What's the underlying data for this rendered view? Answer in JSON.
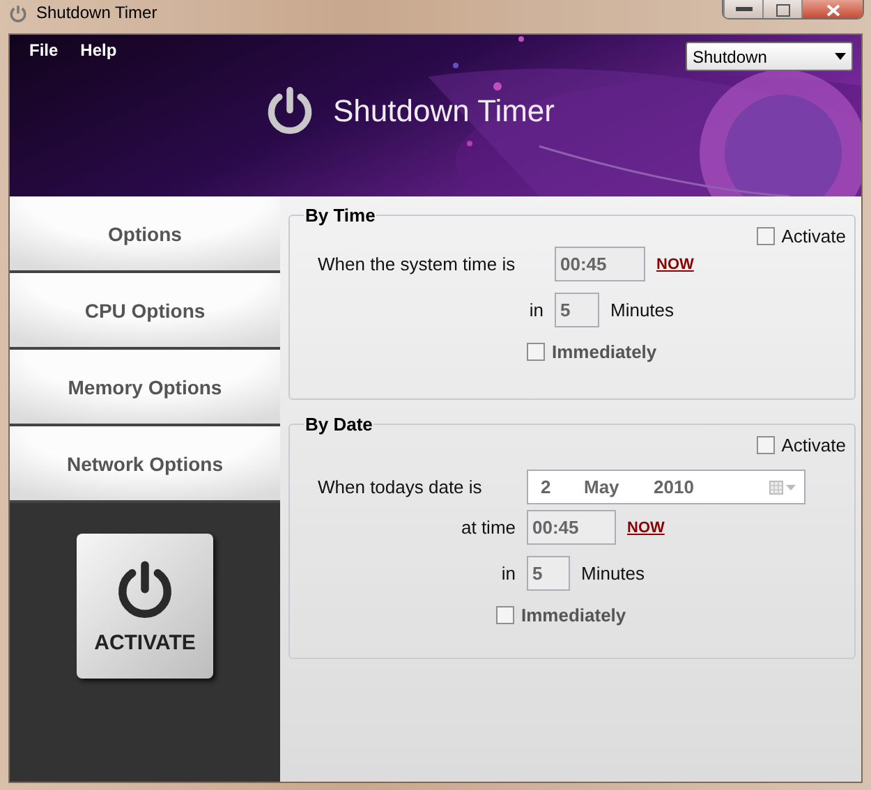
{
  "window": {
    "title": "Shutdown Timer"
  },
  "menu": [
    {
      "label": "File"
    },
    {
      "label": "Help"
    }
  ],
  "action_select": {
    "value": "Shutdown"
  },
  "banner": {
    "title": "Shutdown Timer"
  },
  "sidebar": {
    "items": [
      {
        "label": "Options",
        "selected": false
      },
      {
        "label": "CPU Options",
        "selected": false
      },
      {
        "label": "Memory Options",
        "selected": false
      },
      {
        "label": "Network Options",
        "selected": false
      }
    ],
    "activate_button": {
      "label": "ACTIVATE"
    }
  },
  "by_time": {
    "title": "By Time",
    "activate": {
      "label": "Activate",
      "checked": false
    },
    "time_label": "When the system time is",
    "time": "00:45",
    "now_link": "NOW",
    "in_label": "in",
    "minutes": "5",
    "minutes_label": "Minutes",
    "immediately": {
      "label": "Immediately",
      "checked": false
    }
  },
  "by_date": {
    "title": "By Date",
    "activate": {
      "label": "Activate",
      "checked": false
    },
    "date_label": "When todays date is",
    "date": {
      "day": "2",
      "month": "May",
      "year": "2010"
    },
    "time_label": "at time",
    "time": "00:45",
    "now_link": "NOW",
    "in_label": "in",
    "minutes": "5",
    "minutes_label": "Minutes",
    "immediately": {
      "label": "Immediately",
      "checked": false
    }
  }
}
